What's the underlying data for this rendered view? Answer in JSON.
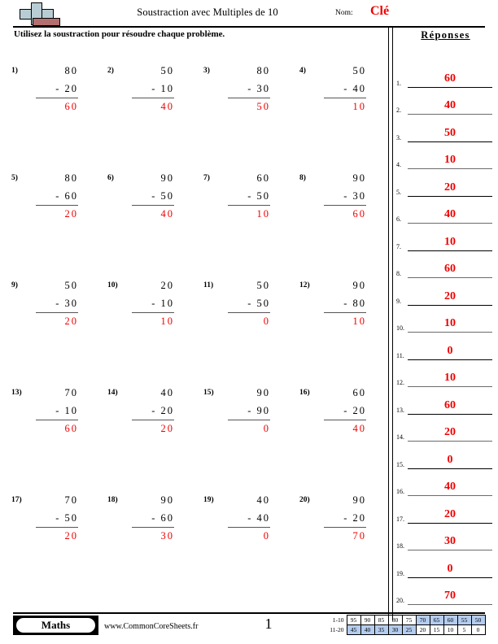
{
  "header": {
    "logo_icon": "math-cross-logo-icon",
    "title": "Soustraction avec Multiples de 10",
    "name_label": "Nom:",
    "name_value": "Clé"
  },
  "instruction": "Utilisez la soustraction pour résoudre chaque problème.",
  "answers_panel": {
    "title": "Réponses",
    "items": [
      {
        "num": "1.",
        "value": "60"
      },
      {
        "num": "2.",
        "value": "40"
      },
      {
        "num": "3.",
        "value": "50"
      },
      {
        "num": "4.",
        "value": "10"
      },
      {
        "num": "5.",
        "value": "20"
      },
      {
        "num": "6.",
        "value": "40"
      },
      {
        "num": "7.",
        "value": "10"
      },
      {
        "num": "8.",
        "value": "60"
      },
      {
        "num": "9.",
        "value": "20"
      },
      {
        "num": "10.",
        "value": "10"
      },
      {
        "num": "11.",
        "value": "0"
      },
      {
        "num": "12.",
        "value": "10"
      },
      {
        "num": "13.",
        "value": "60"
      },
      {
        "num": "14.",
        "value": "20"
      },
      {
        "num": "15.",
        "value": "0"
      },
      {
        "num": "16.",
        "value": "40"
      },
      {
        "num": "17.",
        "value": "20"
      },
      {
        "num": "18.",
        "value": "30"
      },
      {
        "num": "19.",
        "value": "0"
      },
      {
        "num": "20.",
        "value": "70"
      }
    ]
  },
  "problems": [
    {
      "label": "1)",
      "minuend": "80",
      "subtrahend": "- 20",
      "answer": "60"
    },
    {
      "label": "2)",
      "minuend": "50",
      "subtrahend": "- 10",
      "answer": "40"
    },
    {
      "label": "3)",
      "minuend": "80",
      "subtrahend": "- 30",
      "answer": "50"
    },
    {
      "label": "4)",
      "minuend": "50",
      "subtrahend": "- 40",
      "answer": "10"
    },
    {
      "label": "5)",
      "minuend": "80",
      "subtrahend": "- 60",
      "answer": "20"
    },
    {
      "label": "6)",
      "minuend": "90",
      "subtrahend": "- 50",
      "answer": "40"
    },
    {
      "label": "7)",
      "minuend": "60",
      "subtrahend": "- 50",
      "answer": "10"
    },
    {
      "label": "8)",
      "minuend": "90",
      "subtrahend": "- 30",
      "answer": "60"
    },
    {
      "label": "9)",
      "minuend": "50",
      "subtrahend": "- 30",
      "answer": "20"
    },
    {
      "label": "10)",
      "minuend": "20",
      "subtrahend": "- 10",
      "answer": "10"
    },
    {
      "label": "11)",
      "minuend": "50",
      "subtrahend": "- 50",
      "answer": "0"
    },
    {
      "label": "12)",
      "minuend": "90",
      "subtrahend": "- 80",
      "answer": "10"
    },
    {
      "label": "13)",
      "minuend": "70",
      "subtrahend": "- 10",
      "answer": "60"
    },
    {
      "label": "14)",
      "minuend": "40",
      "subtrahend": "- 20",
      "answer": "20"
    },
    {
      "label": "15)",
      "minuend": "90",
      "subtrahend": "- 90",
      "answer": "0"
    },
    {
      "label": "16)",
      "minuend": "60",
      "subtrahend": "- 20",
      "answer": "40"
    },
    {
      "label": "17)",
      "minuend": "70",
      "subtrahend": "- 50",
      "answer": "20"
    },
    {
      "label": "18)",
      "minuend": "90",
      "subtrahend": "- 60",
      "answer": "30"
    },
    {
      "label": "19)",
      "minuend": "40",
      "subtrahend": "- 40",
      "answer": "0"
    },
    {
      "label": "20)",
      "minuend": "90",
      "subtrahend": "- 20",
      "answer": "70"
    }
  ],
  "footer": {
    "subject_badge": "Maths",
    "website": "www.CommonCoreSheets.fr",
    "page_number": "1",
    "score_table": {
      "rows": [
        {
          "head": "1-10",
          "cells": [
            {
              "v": "95",
              "hl": false
            },
            {
              "v": "90",
              "hl": false
            },
            {
              "v": "85",
              "hl": false
            },
            {
              "v": "80",
              "hl": false
            },
            {
              "v": "75",
              "hl": false
            },
            {
              "v": "70",
              "hl": true
            },
            {
              "v": "65",
              "hl": true
            },
            {
              "v": "60",
              "hl": true
            },
            {
              "v": "55",
              "hl": true
            },
            {
              "v": "50",
              "hl": true
            }
          ]
        },
        {
          "head": "11-20",
          "cells": [
            {
              "v": "45",
              "hl": true
            },
            {
              "v": "40",
              "hl": true
            },
            {
              "v": "35",
              "hl": true
            },
            {
              "v": "30",
              "hl": true
            },
            {
              "v": "25",
              "hl": true
            },
            {
              "v": "20",
              "hl": false
            },
            {
              "v": "15",
              "hl": false
            },
            {
              "v": "10",
              "hl": false
            },
            {
              "v": "5",
              "hl": false
            },
            {
              "v": "0",
              "hl": false
            }
          ]
        }
      ]
    }
  },
  "colors": {
    "answer_red": "#ee0000",
    "highlight_blue": "#b4ccee",
    "logo_cross": "#b8ccd4",
    "logo_book": "#b4706e"
  }
}
